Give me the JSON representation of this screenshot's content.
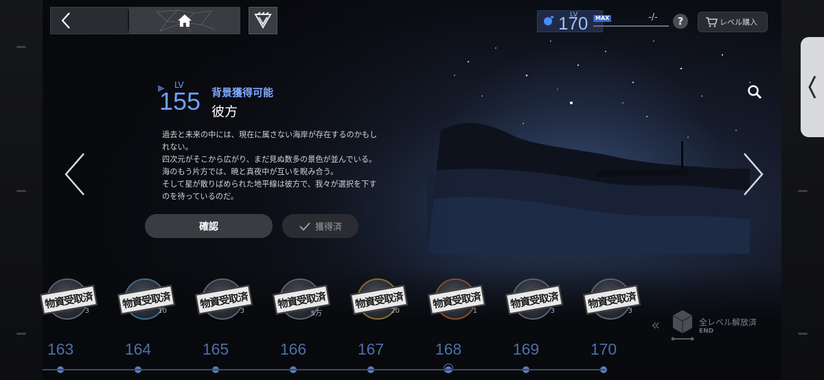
{
  "header": {
    "player_level_label": "LV",
    "player_level": "170",
    "max_badge": "MAX",
    "progress_text": "-/-",
    "help_label": "?",
    "buy_level_label": "レベル購入"
  },
  "detail": {
    "level_label": "LV",
    "level": "155",
    "tag": "背景獲得可能",
    "title": "彼方",
    "description": [
      "過去と未来の中には、現在に属さない海岸が存在するのかもし",
      "れない。",
      "四次元がそこから広がり、まだ見ぬ数多の景色が並んでいる。",
      "海のもう片方では、暁と真夜中が互いを睨み合う。",
      "そして星が散りばめられた地平線は彼方で、我々が選択を下す",
      "のを待っているのだ。"
    ],
    "confirm_label": "確認",
    "obtained_label": "獲得済"
  },
  "rewards": [
    {
      "level": "163",
      "count": "3",
      "stamp": "物資受取済",
      "ring": "#5d6270"
    },
    {
      "level": "164",
      "count": "10",
      "stamp": "物資受取済",
      "ring": "#3f6f8e"
    },
    {
      "level": "165",
      "count": "3",
      "stamp": "物資受取済",
      "ring": "#5d6270"
    },
    {
      "level": "166",
      "count": "5万",
      "stamp": "物資受取済",
      "ring": "#5d6270"
    },
    {
      "level": "167",
      "count": "20",
      "stamp": "物資受取済",
      "ring": "#8a6d2e"
    },
    {
      "level": "168",
      "count": "1",
      "stamp": "物資受取済",
      "ring": "#8a4e2e"
    },
    {
      "level": "169",
      "count": "3",
      "stamp": "物資受取済",
      "ring": "#5d6270"
    },
    {
      "level": "170",
      "count": "3",
      "stamp": "物資受取済",
      "ring": "#5d6270"
    }
  ],
  "all_unlocked": {
    "label": "全レベル解放済",
    "end": "END"
  },
  "icons": [
    "back-arrow-icon",
    "home-icon",
    "game-logo-icon",
    "level-orb-icon",
    "help-icon",
    "cart-icon",
    "search-icon",
    "chevron-left-icon",
    "chevron-right-icon",
    "check-icon",
    "box-icon"
  ],
  "colors": {
    "accent": "#6ea0ff",
    "level_track": "#4d6fa8"
  }
}
